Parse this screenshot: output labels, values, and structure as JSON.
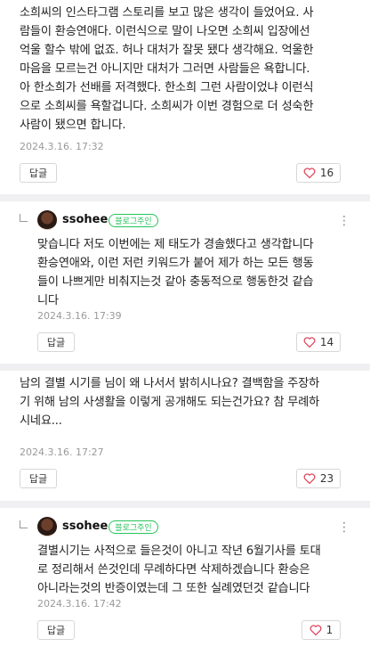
{
  "comments": [
    {
      "text": "소희씨의 인스타그램 스토리를 보고 많은 생각이 들었어요. 사\n람들이 환승연애다. 이런식으로 말이 나오면 소희씨 입장에선\n억울 할수 밖에 없죠. 허나 대처가 잘못 됐다 생각해요. 억울한\n마음을 모르는건 아니지만 대처가 그러면 사람들은 욕합니다.\n아 한소희가 선배를 저격했다. 한소희 그런 사람이었냐 이런식\n으로 소희씨를 욕할겁니다. 소희씨가 이번 경험으로 더 성숙한\n사람이 됐으면 합니다.",
      "time": "2024.3.16. 17:32",
      "reply_label": "답글",
      "likes": "16"
    },
    {
      "author": "ssohee",
      "badge": "블로그주인",
      "text": "맞습니다 저도 이번에는 제 태도가 경솔했다고 생각합니다\n환승연애와, 이런 저런 키워드가 붙어 제가 하는 모든 행동\n들이 나쁘게만 비춰지는것 같아 충동적으로 행동한것 같습\n니다",
      "time": "2024.3.16. 17:39",
      "reply_label": "답글",
      "likes": "14"
    },
    {
      "text": "남의 결별 시기를 님이 왜 나서서 밝히시나요? 결백함을 주장하\n기 위해 남의 사생활을 이렇게 공개해도 되는건가요? 참 무례하\n시네요...",
      "time": "2024.3.16. 17:27",
      "reply_label": "답글",
      "likes": "23"
    },
    {
      "author": "ssohee",
      "badge": "블로그주인",
      "text": "결별시기는 사적으로 들은것이 아니고 작년 6월기사를 토대\n로 정리해서 쓴것인데 무례하다면 삭제하겠습니다 환승은\n아니라는것의 반증이였는데 그 또한 실례였던것 같습니다",
      "time": "2024.3.16. 17:42",
      "reply_label": "답글",
      "likes": "1"
    }
  ],
  "more_icon": "⋮",
  "colors": {
    "heart": "#e0445a",
    "badge": "#27c35a"
  }
}
